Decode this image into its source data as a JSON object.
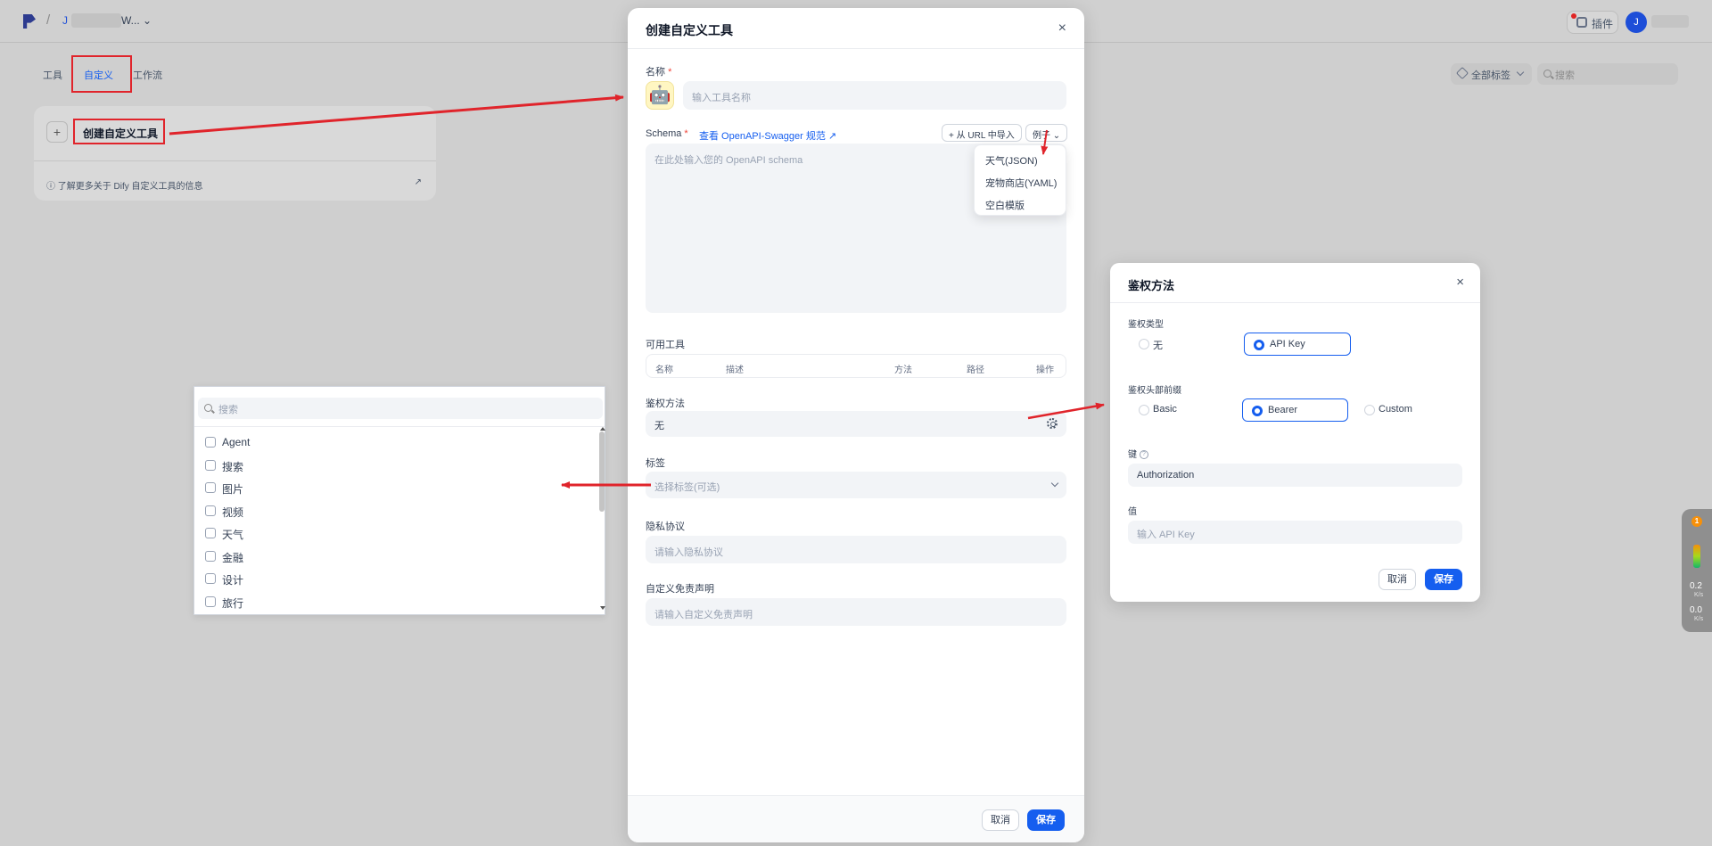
{
  "topbar": {
    "workspace_initial": "J",
    "workspace_suffix": "W... ⌄",
    "plugin_label": "插件",
    "user_initial": "J"
  },
  "nav": {
    "tabs": [
      "工具",
      "自定义",
      "工作流"
    ],
    "tags_filter": "全部标签",
    "search_placeholder": "搜索"
  },
  "create_card": {
    "plus": "+",
    "label": "创建自定义工具",
    "learn_more": "ⓘ 了解更多关于 Dify 自定义工具的信息",
    "ext": "↗"
  },
  "modal": {
    "title": "创建自定义工具",
    "close": "×",
    "name_label": "名称",
    "required_mark": "*",
    "emoji": "🤖",
    "name_placeholder": "输入工具名称",
    "schema_label": "Schema",
    "swagger_link": "查看 OpenAPI-Swagger 规范 ↗",
    "import_url": "+ 从 URL 中导入",
    "example_btn": "例子 ⌄",
    "schema_placeholder": "在此处输入您的 OpenAPI schema",
    "example_items": [
      "天气(JSON)",
      "宠物商店(YAML)",
      "空白模版"
    ],
    "available_tools_label": "可用工具",
    "table_headers": [
      "名称",
      "描述",
      "方法",
      "路径",
      "操作"
    ],
    "auth_label": "鉴权方法",
    "auth_value": "无",
    "tags_label": "标签",
    "tags_placeholder": "选择标签(可选)",
    "privacy_label": "隐私协议",
    "privacy_placeholder": "请输入隐私协议",
    "disclaimer_label": "自定义免责声明",
    "disclaimer_placeholder": "请输入自定义免责声明",
    "cancel": "取消",
    "save": "保存"
  },
  "auth_modal": {
    "title": "鉴权方法",
    "close": "×",
    "type_label": "鉴权类型",
    "type_options": [
      "无",
      "API Key"
    ],
    "type_selected": "API Key",
    "prefix_label": "鉴权头部前缀",
    "prefix_options": [
      "Basic",
      "Bearer",
      "Custom"
    ],
    "prefix_selected": "Bearer",
    "key_label": "键",
    "key_value": "Authorization",
    "value_label": "值",
    "value_placeholder": "输入 API Key",
    "cancel": "取消",
    "save": "保存"
  },
  "tags_dropdown": {
    "search_placeholder": "搜索",
    "items": [
      "Agent",
      "搜索",
      "图片",
      "视频",
      "天气",
      "金融",
      "设计",
      "旅行"
    ]
  },
  "net_widget": {
    "badge": "1",
    "up_value": "0.2",
    "up_unit": "K/s",
    "down_value": "0.0",
    "down_unit": "K/s"
  },
  "colors": {
    "primary": "#155eef",
    "annotation_red": "#e0242b"
  }
}
